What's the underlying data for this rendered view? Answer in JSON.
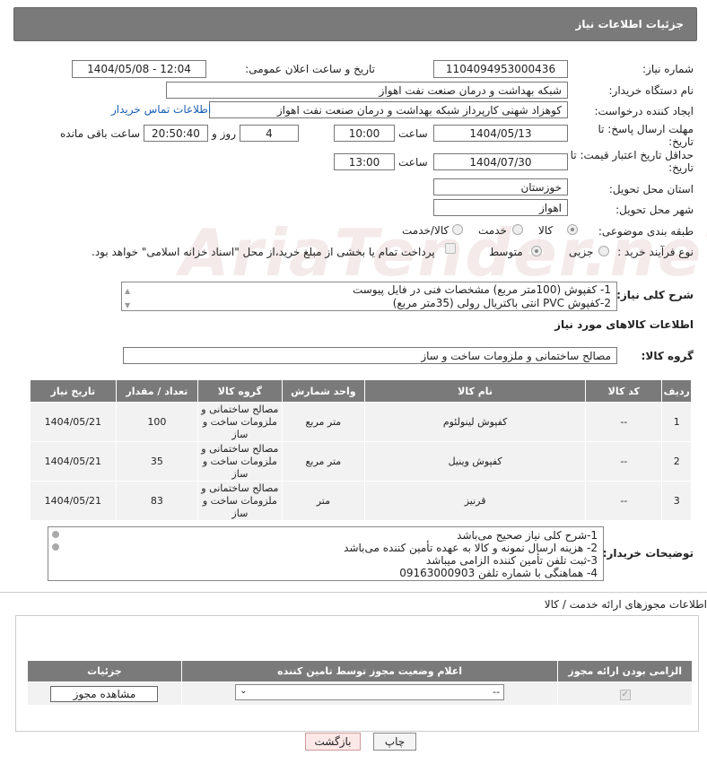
{
  "header": {
    "title": "جزئیات اطلاعات نیاز"
  },
  "form": {
    "need_number_label": "شماره نیاز:",
    "need_number": "1104094953000436",
    "announce_label": "تاریخ و ساعت اعلان عمومی:",
    "announce_value": "1404/05/08 - 12:04",
    "buyer_org_label": "نام دستگاه خریدار:",
    "buyer_org": "شبکه بهداشت و درمان صنعت نفت اهواز",
    "requester_label": "ایجاد کننده درخواست:",
    "requester": "کوهزاد شهنی کارپرداز شبکه بهداشت و درمان صنعت نفت اهواز",
    "contact_link": "اطلاعات تماس خریدار",
    "deadline_label": "مهلت ارسال پاسخ: تا تاریخ:",
    "deadline_date": "1404/05/13",
    "time_word": "ساعت",
    "deadline_time": "10:00",
    "days_value": "4",
    "days_word": "روز و",
    "remaining_time": "20:50:40",
    "remaining_word": "ساعت باقی مانده",
    "validity_label": "حداقل تاریخ اعتبار قیمت: تا تاریخ:",
    "validity_date": "1404/07/30",
    "validity_time": "13:00",
    "province_label": "استان محل تحویل:",
    "province": "خوزستان",
    "city_label": "شهر محل تحویل:",
    "city": "اهواز",
    "category_label": "طبقه بندی موضوعی:",
    "cat_goods": "کالا",
    "cat_service": "خدمت",
    "cat_both": "کالا/خدمت",
    "process_label": "نوع فرآیند خرید :",
    "proc_partial": "جزیی",
    "proc_medium": "متوسط",
    "payment_note": "پرداخت تمام یا بخشی از مبلغ خرید،از محل \"اسناد خزانه اسلامی\" خواهد بود.",
    "summary_label": "شرح کلی نیاز:",
    "summary_line1": "1-  کفپوش (100متر مربع) مشخصات فنی در فایل پیوست",
    "summary_line2": "2-کفپوش PVC انتی باکتریال رولی (35متر مربع)",
    "goods_info_title": "اطلاعات کالاهای مورد نیاز",
    "group_label": "گروه کالا:",
    "group_value": "مصالح ساختمانی و ملزومات ساخت و ساز"
  },
  "table": {
    "headers": [
      "ردیف",
      "کد کالا",
      "نام کالا",
      "واحد شمارش",
      "گروه کالا",
      "تعداد / مقدار",
      "تاریخ نیاز"
    ],
    "rows": [
      {
        "idx": "1",
        "code": "--",
        "name": "کفپوش لینولئوم",
        "unit": "متر مربع",
        "group": "مصالح ساختمانی و ملزومات ساخت و ساز",
        "qty": "100",
        "date": "1404/05/21"
      },
      {
        "idx": "2",
        "code": "--",
        "name": "کفپوش وینیل",
        "unit": "متر مربع",
        "group": "مصالح ساختمانی و ملزومات ساخت و ساز",
        "qty": "35",
        "date": "1404/05/21"
      },
      {
        "idx": "3",
        "code": "--",
        "name": "قرنیز",
        "unit": "متر",
        "group": "مصالح ساختمانی و ملزومات ساخت و ساز",
        "qty": "83",
        "date": "1404/05/21"
      }
    ]
  },
  "buyer_notes": {
    "label": "توضیحات خریدار:",
    "lines": [
      "1-شرح کلی نیاز صحیح می‌باشد",
      "2- هزینه ارسال نمونه و کالا به عهده تأمین کننده می‌باشد",
      "3-ثبت تلفن تأمین کننده الزامی میباشد",
      "4- هماهنگی با شماره تلفن 09163000903"
    ]
  },
  "licenses": {
    "title": "اطلاعات مجوزهای ارائه خدمت / کالا",
    "headers": [
      "الزامی بودن ارائه مجوز",
      "اعلام وضعیت مجوز توسط تامین کننده",
      "جزئیات"
    ],
    "select_value": "--",
    "view_button": "مشاهده مجوز"
  },
  "buttons": {
    "print": "چاپ",
    "back": "بازگشت"
  },
  "watermark": "AriaTender.neT"
}
